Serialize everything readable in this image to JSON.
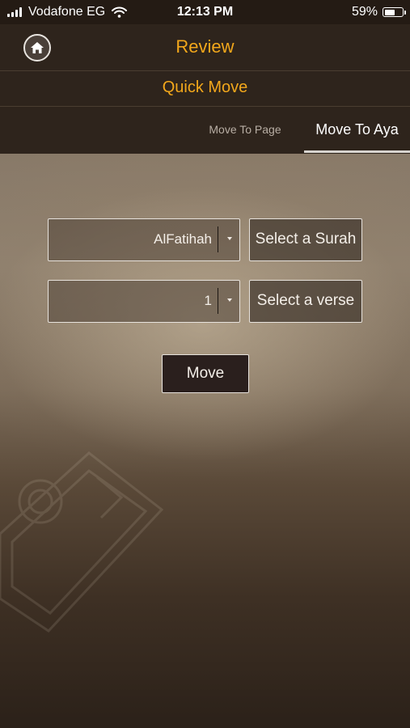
{
  "status_bar": {
    "carrier": "Vodafone EG",
    "time": "12:13 PM",
    "battery_percent": "59%",
    "battery_level": 0.59
  },
  "header": {
    "title": "Review",
    "subtitle": "Quick Move",
    "home_icon": "home-icon",
    "accent_color": "#f2a71b"
  },
  "tabs": [
    {
      "label": "Move To Page",
      "selected": false
    },
    {
      "label": "Move To Aya",
      "selected": true
    }
  ],
  "form": {
    "surah": {
      "value": "AlFatihah",
      "button_label": "Select a Surah"
    },
    "verse": {
      "value": "1",
      "button_label": "Select a verse"
    },
    "move_label": "Move"
  }
}
